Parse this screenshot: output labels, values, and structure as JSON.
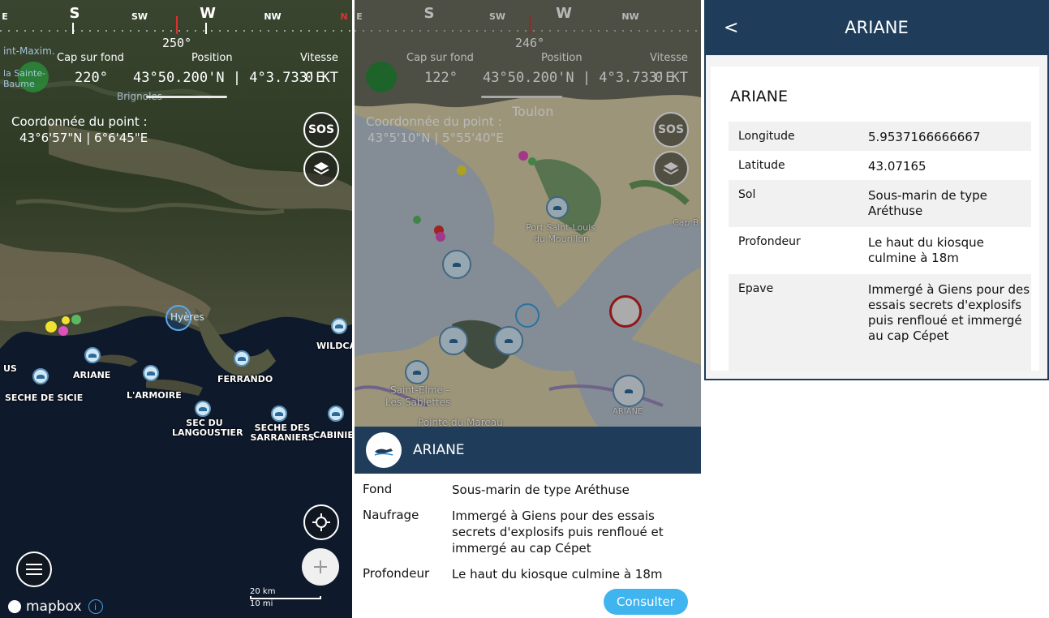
{
  "panel1": {
    "compass": {
      "s": "S",
      "sw": "SW",
      "w": "W",
      "nw": "NW",
      "n": "N",
      "e": "E"
    },
    "heading": "250°",
    "hud": {
      "cap_label": "Cap sur fond",
      "cap_value": "220°",
      "position_label": "Position",
      "position_value": "43°50.200'N | 4°3.733'E",
      "speed_label": "Vitesse",
      "speed_value": "0 KT"
    },
    "coord_label": "Coordonnée du point :",
    "coord_value": "43°6'57\"N | 6°6'45\"E",
    "sos_label": "SOS",
    "place_labels": {
      "town_top": "int-Maxim.",
      "town_top2": "la Sainte-Baume",
      "brignoles": "Brignoles",
      "hyeres": "Hyères"
    },
    "markers": [
      "ARIANE",
      "FERRANDO",
      "L'ARMOIRE",
      "SECHE DE SICIE",
      "SEC DU LANGOUSTIER",
      "SECHE DES SARRANIERS",
      "WILDCA",
      "CABINIE",
      "US"
    ],
    "scale": {
      "km": "20 km",
      "mi": "10 mi"
    },
    "brand": "mapbox",
    "info_icon": "i"
  },
  "panel2": {
    "compass": {
      "s": "S",
      "sw": "SW",
      "w": "W",
      "nw": "NW",
      "e": "E"
    },
    "heading": "246°",
    "hud": {
      "cap_label": "Cap sur fond",
      "cap_value": "122°",
      "position_label": "Position",
      "position_value": "43°50.200'N | 4°3.733'E",
      "speed_label": "Vitesse",
      "speed_value": "0 KT"
    },
    "coord_label": "Coordonnée du point :",
    "coord_value": "43°5'10\"N | 5°55'40\"E",
    "sos_label": "SOS",
    "place_labels": {
      "toulon": "Toulon",
      "port": "Port Saint-Louis",
      "port2": "du Mourillon",
      "cap": "Cap B",
      "saint_elme": "Saint-Elme -",
      "saint_elme2": "Les Sablettes",
      "pointe": "Pointe du Mareau",
      "ariane": "ARIANE"
    },
    "sheet": {
      "title": "ARIANE",
      "rows": [
        {
          "k": "Fond",
          "v": "Sous-marin de type Aréthuse"
        },
        {
          "k": "Naufrage",
          "v": "Immergé à Giens pour des essais secrets d'explosifs puis renfloué et immergé au cap Cépet"
        },
        {
          "k": "Profondeur",
          "v": "Le haut du kiosque culmine à 18m"
        }
      ],
      "button": "Consulter"
    }
  },
  "panel3": {
    "back": "<",
    "title": "ARIANE",
    "name": "ARIANE",
    "rows": [
      {
        "k": "Longitude",
        "v": "5.9537166666667"
      },
      {
        "k": "Latitude",
        "v": "43.07165"
      },
      {
        "k": "Sol",
        "v": "Sous-marin de type Aréthuse"
      },
      {
        "k": "Profondeur",
        "v": "Le haut du kiosque culmine à 18m"
      },
      {
        "k": "Epave",
        "v": "Immergé à Giens pour des essais secrets d'explosifs puis renfloué et immergé au cap Cépet"
      }
    ]
  },
  "colors": {
    "header": "#1f3d5a",
    "accent": "#40b4ee"
  }
}
